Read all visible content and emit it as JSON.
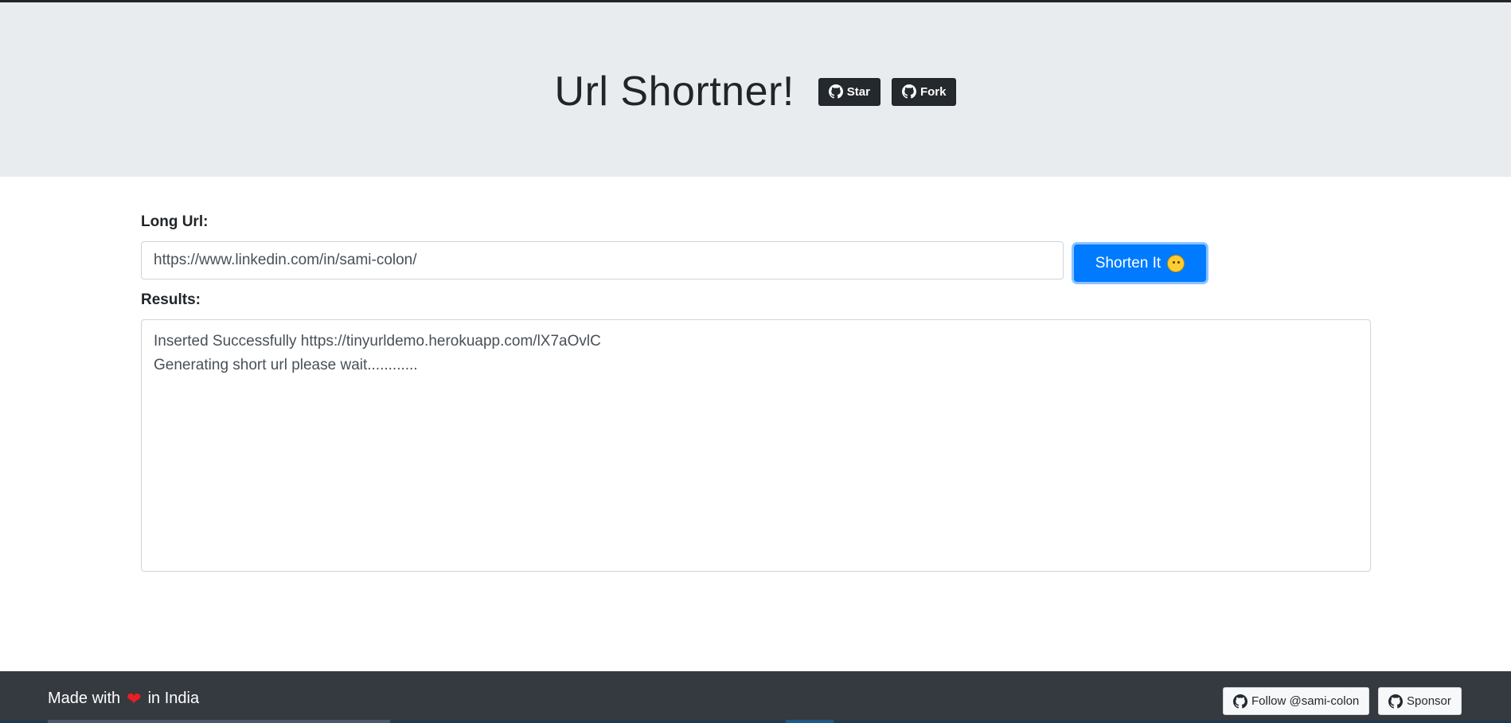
{
  "header": {
    "title": "Url Shortner!",
    "star_label": "Star",
    "fork_label": "Fork"
  },
  "form": {
    "long_url_label": "Long Url:",
    "long_url_value": "https://www.linkedin.com/in/sami-colon/",
    "shorten_label": "Shorten It",
    "results_label": "Results:",
    "results_text": "Inserted Successfully https://tinyurldemo.herokuapp.com/lX7aOvlC\nGenerating short url please wait............"
  },
  "footer": {
    "made_with": "Made with",
    "heart": "❤",
    "in_india": "in India",
    "follow_label": "Follow @sami-colon",
    "sponsor_label": "Sponsor"
  },
  "colors": {
    "primary": "#007bff",
    "jumbotron_bg": "#e9ecef",
    "footer_bg": "#343a40",
    "github_dark": "#24292e",
    "heart": "#ee1c25"
  },
  "icons": {
    "github": "github-icon",
    "emoji": "smiling-face-icon",
    "heart": "heart-icon"
  }
}
